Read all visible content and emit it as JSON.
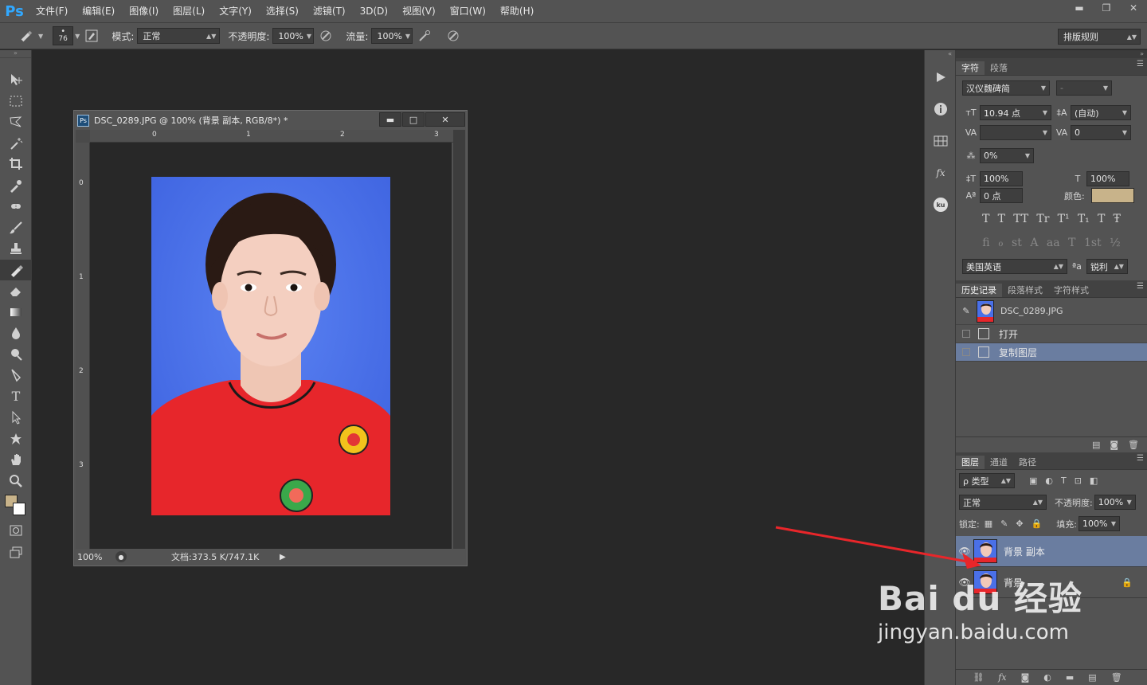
{
  "app": {
    "logo": "Ps"
  },
  "menu": {
    "items": [
      "文件(F)",
      "编辑(E)",
      "图像(I)",
      "图层(L)",
      "文字(Y)",
      "选择(S)",
      "滤镜(T)",
      "3D(D)",
      "视图(V)",
      "窗口(W)",
      "帮助(H)"
    ]
  },
  "window_controls": {
    "minimize": "▬",
    "restore": "❐",
    "close": "✕"
  },
  "options_bar": {
    "brush_size": "76",
    "mode_label": "模式:",
    "mode_value": "正常",
    "opacity_label": "不透明度:",
    "opacity_value": "100%",
    "flow_label": "流量:",
    "flow_value": "100%",
    "workspace": "排版规则"
  },
  "colors": {
    "foreground": "#c8b38a",
    "background": "#ffffff",
    "accent": "#31a8ff",
    "selection": "#6a7da0",
    "annotation_arrow": "#e8262a"
  },
  "document": {
    "title": "DSC_0289.JPG @ 100% (背景 副本, RGB/8*) *",
    "ps_badge": "Ps",
    "ruler_h": [
      "0",
      "1",
      "2",
      "3"
    ],
    "ruler_v": [
      "0",
      "1",
      "2",
      "3"
    ],
    "zoom": "100%",
    "doc_info": "文档:373.5 K/747.1K"
  },
  "character_panel": {
    "tabs": [
      "字符",
      "段落"
    ],
    "font_family": "汉仪魏碑简",
    "font_style": "-",
    "size": "10.94 点",
    "leading": "(自动)",
    "kerning": "",
    "tracking": "0",
    "scale_pct": "0%",
    "vscale": "100%",
    "hscale": "100%",
    "baseline": "0 点",
    "color_label": "颜色:",
    "style_glyphs": [
      "T",
      "T",
      "TT",
      "Tr",
      "T¹",
      "T₁",
      "T",
      "Ŧ"
    ],
    "opentype_glyphs": [
      "fi",
      "ℴ",
      "st",
      "A",
      "aa",
      "T",
      "1st",
      "½"
    ],
    "language": "美国英语",
    "aa_label": "ªa",
    "antialias": "锐利"
  },
  "history_panel": {
    "tabs": [
      "历史记录",
      "段落样式",
      "字符样式"
    ],
    "snapshot": "DSC_0289.JPG",
    "items": [
      {
        "label": "打开",
        "selected": false
      },
      {
        "label": "复制图层",
        "selected": true
      }
    ]
  },
  "layers_panel": {
    "tabs": [
      "图层",
      "通道",
      "路径"
    ],
    "filter_label": "ρ 类型",
    "blend_mode": "正常",
    "opacity_label": "不透明度:",
    "opacity_value": "100%",
    "lock_label": "锁定:",
    "fill_label": "填充:",
    "fill_value": "100%",
    "layers": [
      {
        "name": "背景 副本",
        "selected": true,
        "locked": false
      },
      {
        "name": "背景",
        "selected": false,
        "locked": true
      }
    ]
  },
  "watermark": {
    "logo": "Bai du 经验",
    "url": "jingyan.baidu.com"
  }
}
